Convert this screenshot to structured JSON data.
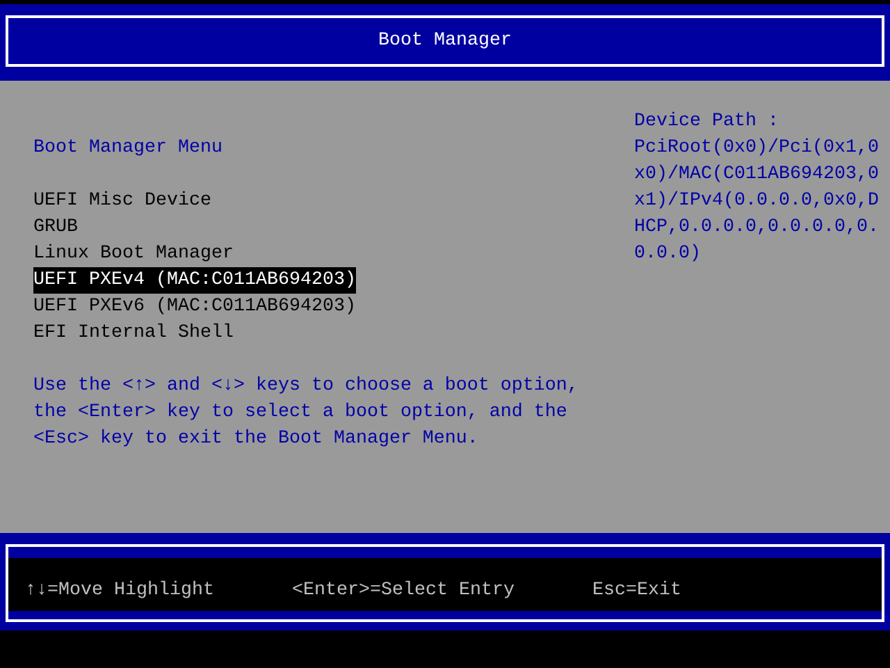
{
  "window": {
    "title": "Boot Manager"
  },
  "menu": {
    "title": "Boot Manager Menu",
    "items": [
      {
        "label": "UEFI Misc Device",
        "selected": false
      },
      {
        "label": "GRUB",
        "selected": false
      },
      {
        "label": "Linux Boot Manager",
        "selected": false
      },
      {
        "label": "UEFI PXEv4 (MAC:C011AB694203)",
        "selected": true
      },
      {
        "label": "UEFI PXEv6 (MAC:C011AB694203)",
        "selected": false
      },
      {
        "label": "EFI Internal Shell",
        "selected": false
      }
    ],
    "help": [
      "Use the <↑> and <↓> keys to choose a boot option,",
      "the <Enter> key to select a boot option, and the",
      "<Esc> key to exit the Boot Manager Menu."
    ]
  },
  "device_path": {
    "label": "Device Path :",
    "value": "PciRoot(0x0)/Pci(0x1,0x0)/MAC(C011AB694203,0x1)/IPv4(0.0.0.0,0x0,DHCP,0.0.0.0,0.0.0.0,0.0.0.0)"
  },
  "status_bar": [
    "↑↓=Move Highlight",
    "<Enter>=Select Entry",
    "Esc=Exit"
  ]
}
